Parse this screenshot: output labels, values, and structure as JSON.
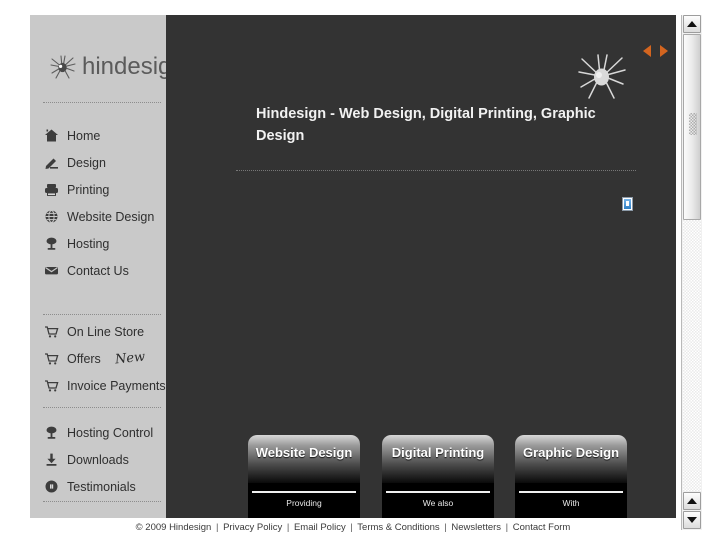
{
  "brand": {
    "name": "hindesign",
    "logo_icon": "spider-icon"
  },
  "sidebar": {
    "groups": [
      {
        "id": "main",
        "items": [
          {
            "label": "Home",
            "icon": "home-icon"
          },
          {
            "label": "Design",
            "icon": "pen-icon"
          },
          {
            "label": "Printing",
            "icon": "printer-icon"
          },
          {
            "label": "Website Design",
            "icon": "globe-icon"
          },
          {
            "label": "Hosting",
            "icon": "server-icon"
          },
          {
            "label": "Contact Us",
            "icon": "envelope-icon"
          }
        ]
      },
      {
        "id": "store",
        "items": [
          {
            "label": "On Line Store",
            "icon": "cart-icon",
            "badge": ""
          },
          {
            "label": "Offers",
            "icon": "cart-icon",
            "badge": "New"
          },
          {
            "label": "Invoice Payments",
            "icon": "cart-icon",
            "badge": ""
          }
        ]
      },
      {
        "id": "support",
        "items": [
          {
            "label": "Hosting Control",
            "icon": "server-icon"
          },
          {
            "label": "Downloads",
            "icon": "download-icon"
          },
          {
            "label": "Testimonials",
            "icon": "quote-icon"
          }
        ]
      }
    ]
  },
  "content": {
    "header_spider_icon": "spider-icon",
    "pager": {
      "prev_icon": "triangle-left-icon",
      "next_icon": "triangle-right-icon",
      "arrow_color": "#d4651f"
    },
    "page_title": "Hindesign - Web Design, Digital Printing, Graphic Design",
    "broken_image_icon": "broken-image-icon",
    "panels": [
      {
        "title": "Website Design",
        "body": "Providing"
      },
      {
        "title": "Digital Printing",
        "body": "We    also"
      },
      {
        "title": "Graphic Design",
        "body": "With"
      }
    ]
  },
  "footer": {
    "items": [
      "© 2009 Hindesign",
      "Privacy Policy",
      "Email Policy",
      "Terms & Conditions",
      "Newsletters",
      "Contact Form"
    ],
    "separator": "|"
  },
  "scrollbar": {
    "up_icon": "scroll-up-icon",
    "down_icon": "scroll-down-icon",
    "secondary_up_icon": "scroll-up-icon"
  }
}
